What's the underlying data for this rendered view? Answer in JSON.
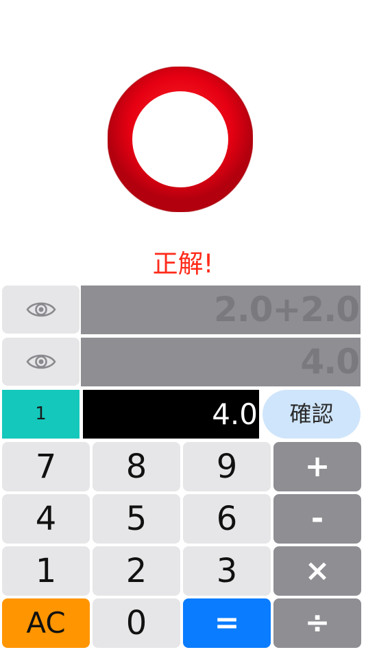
{
  "result": {
    "icon": "red-circle-correct-icon",
    "ring_color": "#e60012",
    "message": "正解!",
    "message_color": "#ff2a1a"
  },
  "displays": {
    "expression": "2.0+2.0",
    "result": "4.0"
  },
  "question": {
    "number": "1",
    "answer": "4.0",
    "confirm_label": "確認"
  },
  "keypad": {
    "row1": [
      "7",
      "8",
      "9",
      "+"
    ],
    "row2": [
      "4",
      "5",
      "6",
      "-"
    ],
    "row3": [
      "1",
      "2",
      "3",
      "×"
    ],
    "row4": [
      "AC",
      "0",
      "=",
      "÷"
    ]
  },
  "colors": {
    "number_key": "#e6e6e8",
    "operator_key": "#8e8e93",
    "clear_key": "#ff9500",
    "equals_key": "#0a7cff",
    "question_badge": "#14c8bb",
    "confirm_button": "#cfe5fb"
  }
}
